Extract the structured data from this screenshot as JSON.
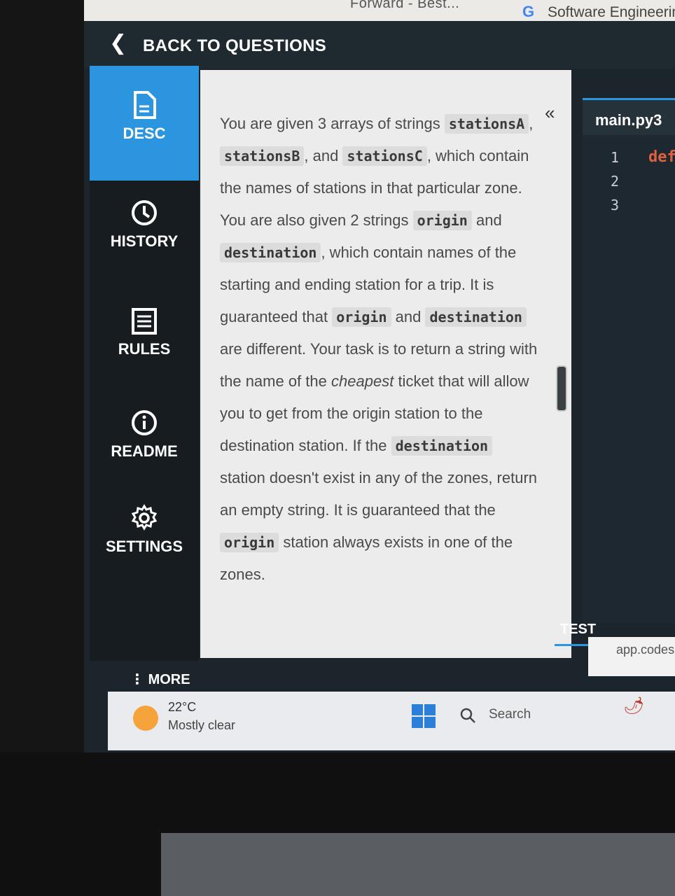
{
  "browser": {
    "prev_tab_text": "Forward - Best...",
    "next_tab_text": "Software Engineerin",
    "next_tab_icon": "google-g-icon"
  },
  "header": {
    "back_label": "BACK TO QUESTIONS",
    "back_icon": "chevron-left-icon"
  },
  "sidebar": {
    "items": [
      {
        "label": "DESC",
        "icon": "document-icon",
        "active": true
      },
      {
        "label": "HISTORY",
        "icon": "clock-icon",
        "active": false
      },
      {
        "label": "RULES",
        "icon": "list-icon",
        "active": false
      },
      {
        "label": "README",
        "icon": "info-icon",
        "active": false
      },
      {
        "label": "SETTINGS",
        "icon": "gear-icon",
        "active": false
      }
    ],
    "more_label": "MORE",
    "active_color": "#2c95e0"
  },
  "description": {
    "collapse_icon": "double-chevron-left-icon",
    "p1": "You are given 3 arrays of strings",
    "c1": "stationsA",
    "sep1": ",",
    "c2": "stationsB",
    "t2": ", and",
    "c3": "stationsC",
    "t3": ", which contain the names of stations in that particular zone. You are also given 2 strings",
    "c4": "origin",
    "t4": "and",
    "c5": "destination",
    "t5": ", which contain names of the starting and ending station for a trip. It is guaranteed that",
    "c6": "origin",
    "t6": "and",
    "c7": "destination",
    "t7": "are different. Your task is to return a string with the name of the",
    "em1": "cheapest",
    "t8": "ticket that will allow you to get from the origin station to the destination station. If the",
    "c8": "destination",
    "t9": "station doesn't exist in any of the zones, return an empty string. It is guaranteed that the",
    "c9": "origin",
    "t10": "station always exists in one of the zones."
  },
  "editor": {
    "file_tab": "main.py3",
    "line_numbers": [
      "1",
      "2",
      "3"
    ],
    "line1_code": "def"
  },
  "bottom": {
    "tests_label": "TEST",
    "status_chip": "app.codesi"
  },
  "taskbar": {
    "temperature": "22°C",
    "condition": "Mostly clear",
    "search_label": "Search"
  }
}
